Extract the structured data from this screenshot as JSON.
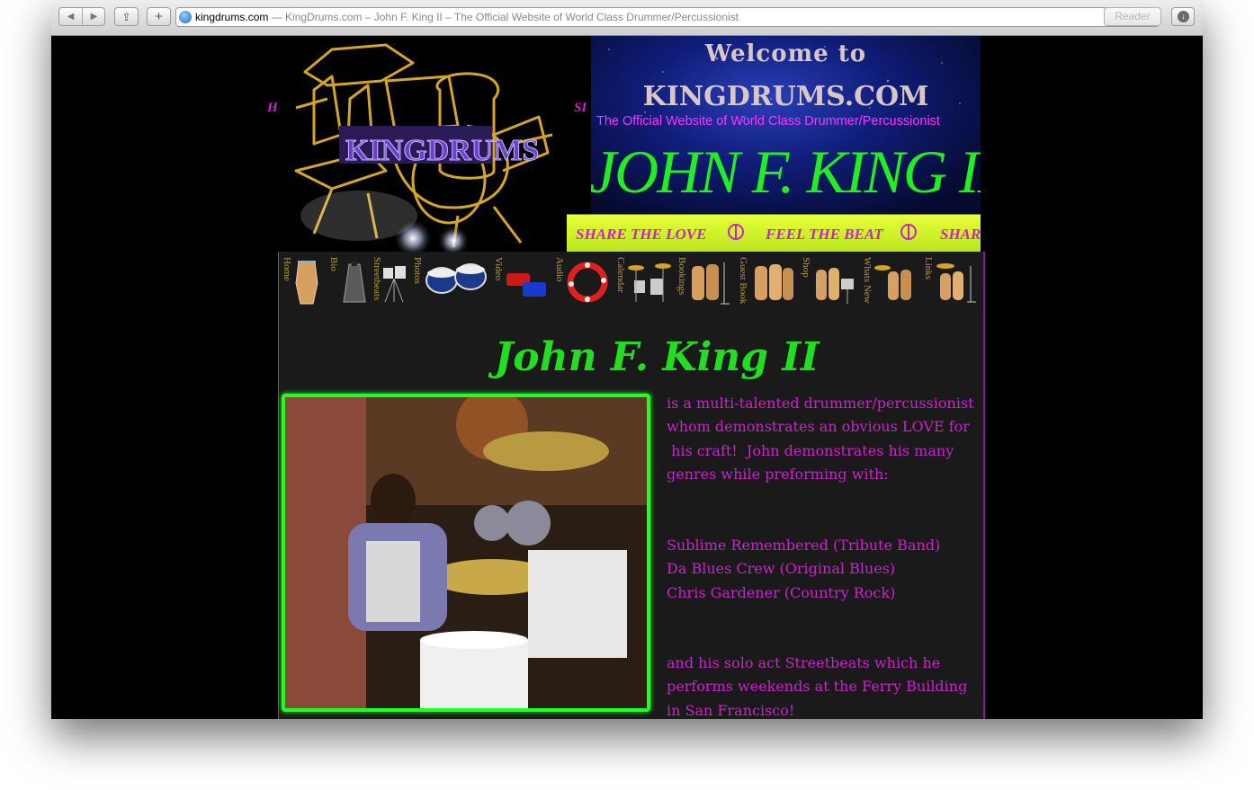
{
  "browser": {
    "domain": "kingdrums.com",
    "page_title": " — KingDrums.com – John F. King II – The Official Website of World Class Drummer/Percussionist",
    "reader_label": "Reader"
  },
  "header": {
    "left_fragment": "H",
    "right_fragment": "SI",
    "logo_text": "KINGDRUMS",
    "welcome_line1": "Welcome to",
    "welcome_line2": "KINGDRUMS.COM",
    "tagline": "The Official Website of World Class Drummer/Percussionist",
    "name": "JOHN F. KING II"
  },
  "marquee": {
    "items": [
      "SHARE THE LOVE",
      "FEEL THE BEAT",
      "SHAR"
    ]
  },
  "nav": {
    "items": [
      {
        "label": "Home",
        "icon": "conga-icon"
      },
      {
        "label": "Bio",
        "icon": "cowbell-icon"
      },
      {
        "label": "Streetbeats",
        "icon": "bongos-icon"
      },
      {
        "label": "Photos",
        "icon": "bongos-icon"
      },
      {
        "label": "Video",
        "icon": "jam-block-icon"
      },
      {
        "label": "Audio",
        "icon": "tambourine-icon"
      },
      {
        "label": "Calendar",
        "icon": "drum-kit-icon"
      },
      {
        "label": "Bookings",
        "icon": "conga-set-icon"
      },
      {
        "label": "Guest Book",
        "icon": "conga-set-icon"
      },
      {
        "label": "Shop",
        "icon": "drum-kit-icon"
      },
      {
        "label": "Whats New",
        "icon": "conga-set-icon"
      },
      {
        "label": "Links",
        "icon": "drum-kit-icon"
      }
    ]
  },
  "main": {
    "heading": "John F. King II",
    "intro_lines": [
      "is a multi-talented drummer/percussionist",
      "whom demonstrates an obvious LOVE for",
      " his craft!  John demonstrates his many",
      "genres while preforming with:"
    ],
    "bands": [
      "Sublime Remembered (Tribute Band)",
      "Da Blues Crew (Original Blues)",
      "Chris Gardener (Country Rock)"
    ],
    "solo_lines": [
      "and his solo act Streetbeats which he",
      "performs weekends at the Ferry Building",
      "in San Francisco!"
    ]
  },
  "colors": {
    "accent_green": "#22ee22",
    "accent_magenta": "#cc22cc",
    "marquee_yellow": "#d4f22c"
  }
}
